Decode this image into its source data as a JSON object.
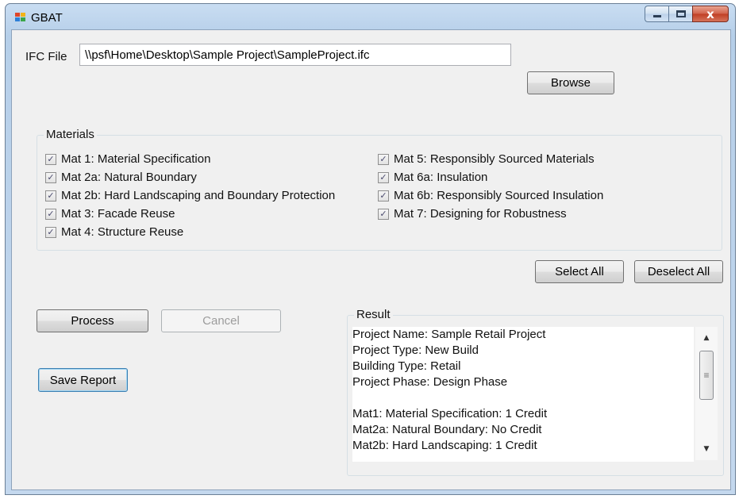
{
  "window": {
    "title": "GBAT",
    "minimize_icon": "minimize-icon",
    "maximize_icon": "maximize-icon",
    "close_glyph": "x"
  },
  "ifc": {
    "label": "IFC File",
    "path": "\\\\psf\\Home\\Desktop\\Sample Project\\SampleProject.ifc",
    "browse_label": "Browse"
  },
  "materials": {
    "title": "Materials",
    "left": [
      {
        "label": "Mat 1: Material Specification",
        "checked": true
      },
      {
        "label": "Mat 2a: Natural Boundary",
        "checked": true
      },
      {
        "label": "Mat 2b: Hard Landscaping and Boundary Protection",
        "checked": true
      },
      {
        "label": "Mat 3: Facade Reuse",
        "checked": true
      },
      {
        "label": "Mat 4: Structure Reuse",
        "checked": true
      }
    ],
    "right": [
      {
        "label": "Mat 5: Responsibly Sourced Materials",
        "checked": true
      },
      {
        "label": "Mat 6a: Insulation",
        "checked": true
      },
      {
        "label": "Mat 6b: Responsibly Sourced Insulation",
        "checked": true
      },
      {
        "label": "Mat 7: Designing for Robustness",
        "checked": true
      }
    ],
    "check_glyph": "✓",
    "select_all_label": "Select All",
    "deselect_all_label": "Deselect All"
  },
  "actions": {
    "process_label": "Process",
    "cancel_label": "Cancel",
    "save_report_label": "Save Report"
  },
  "result": {
    "title": "Result",
    "lines": [
      "Project Name: Sample Retail Project",
      "Project Type: New Build",
      "Building Type: Retail",
      "Project Phase: Design Phase",
      "",
      "Mat1: Material Specification: 1 Credit",
      "Mat2a: Natural Boundary: No Credit",
      "Mat2b: Hard Landscaping: 1 Credit"
    ],
    "scroll_up_glyph": "▲",
    "scroll_down_glyph": "▼",
    "scroll_thumb_glyph": "≡"
  }
}
